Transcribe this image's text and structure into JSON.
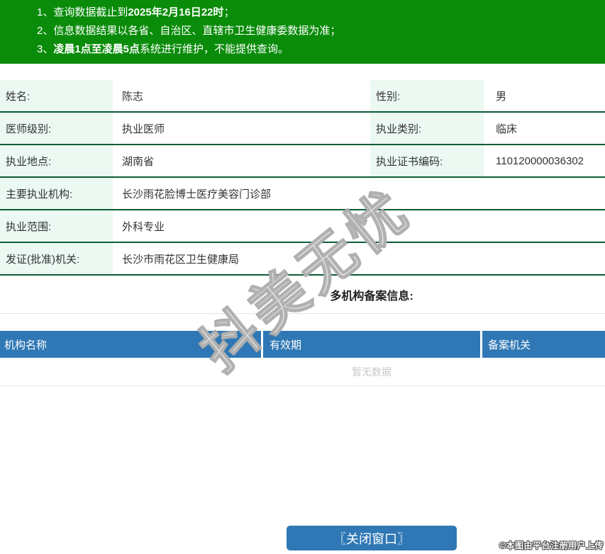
{
  "notice": {
    "lines": [
      {
        "pre": "1、查询数据截止到",
        "bold": "2025年2月16日22时",
        "post": "；"
      },
      {
        "pre": "2、信息数据结果以各省、自治区、直辖市卫生健康委数据为准；",
        "bold": "",
        "post": ""
      },
      {
        "pre": "3、",
        "bold": "凌晨1点至凌晨5点",
        "post": "系统进行维护，不能提供查询。"
      }
    ]
  },
  "info": {
    "rows": [
      {
        "label1": "姓名:",
        "value1": "陈志",
        "label2": "性别:",
        "value2": "男"
      },
      {
        "label1": "医师级别:",
        "value1": "执业医师",
        "label2": "执业类别:",
        "value2": "临床"
      },
      {
        "label1": "执业地点:",
        "value1": "湖南省",
        "label2": "执业证书编码:",
        "value2": "110120000036302"
      },
      {
        "label1": "主要执业机构:",
        "value1": "长沙雨花脸博士医疗美容门诊部"
      },
      {
        "label1": "执业范围:",
        "value1": "外科专业"
      },
      {
        "label1": "发证(批准)机关:",
        "value1": "长沙市雨花区卫生健康局"
      }
    ]
  },
  "section": {
    "title": "多机构备案信息:"
  },
  "filing_table": {
    "headers": [
      "机构名称",
      "有效期",
      "备案机关"
    ],
    "empty_text": "暂无数据"
  },
  "footer": {
    "close_button": "〖关闭窗口〗",
    "copyright": "©本图由平台注册用户上传"
  },
  "watermark": {
    "text": "抖美无忧"
  },
  "colors": {
    "banner_green": "#0a8c0a",
    "row_border_green": "#0b5c35",
    "label_cell_mint": "#ebf9f2",
    "table_header_blue": "#2f78b5",
    "button_blue": "#2f78b5",
    "empty_text_gray": "#c8c8c8"
  }
}
